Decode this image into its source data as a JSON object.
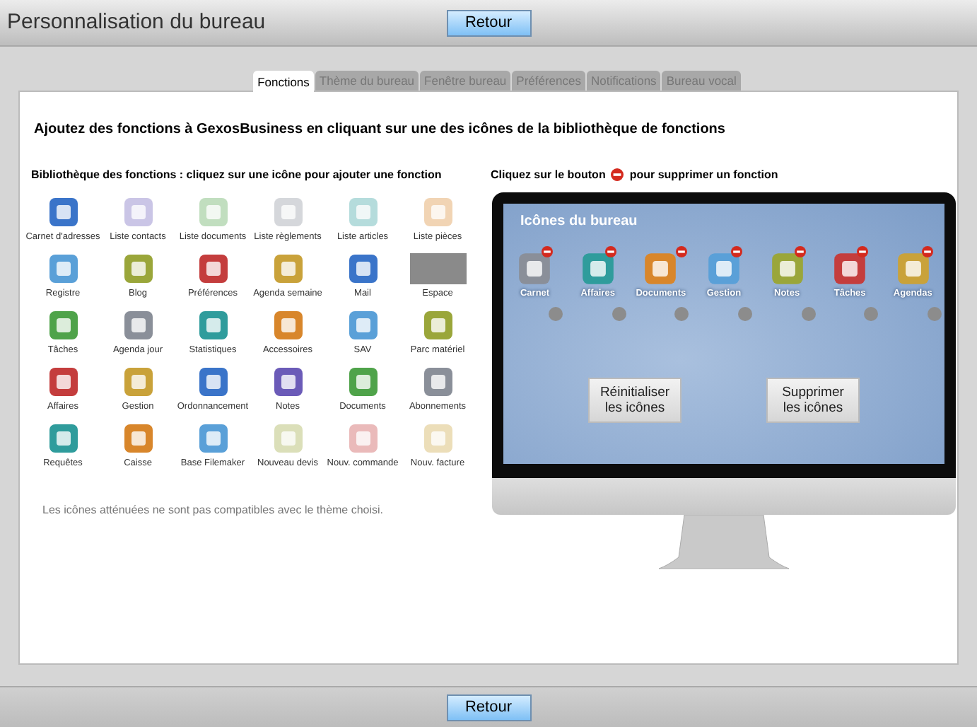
{
  "window": {
    "title": "Personnalisation du bureau"
  },
  "top_button": "Retour",
  "tabs": [
    {
      "label": "Fonctions",
      "selected": true
    },
    {
      "label": "Thème du bureau",
      "selected": false
    },
    {
      "label": "Fenêtre bureau",
      "selected": false
    },
    {
      "label": "Préférences",
      "selected": false
    },
    {
      "label": "Notifications",
      "selected": false
    },
    {
      "label": "Bureau vocal",
      "selected": false
    }
  ],
  "heading": "Ajoutez des fonctions à GexosBusiness en cliquant sur une  des icônes de la bibliothèque de fonctions",
  "library": {
    "title": "Bibliothèque des fonctions : cliquez sur une icône pour ajouter une fonction",
    "items": [
      {
        "label": "Carnet d'adresses",
        "kind": "icon",
        "dimmed": false
      },
      {
        "label": "Liste contacts",
        "kind": "icon",
        "dimmed": true
      },
      {
        "label": "Liste documents",
        "kind": "icon",
        "dimmed": true
      },
      {
        "label": "Liste règlements",
        "kind": "icon",
        "dimmed": true
      },
      {
        "label": "Liste articles",
        "kind": "icon",
        "dimmed": true
      },
      {
        "label": "Liste pièces",
        "kind": "icon",
        "dimmed": true
      },
      {
        "label": "Registre",
        "kind": "icon",
        "dimmed": false
      },
      {
        "label": "Blog",
        "kind": "icon",
        "dimmed": false
      },
      {
        "label": "Préférences",
        "kind": "icon",
        "dimmed": false
      },
      {
        "label": "Agenda semaine",
        "kind": "icon",
        "dimmed": false
      },
      {
        "label": "Mail",
        "kind": "icon",
        "dimmed": false
      },
      {
        "label": "Espace",
        "kind": "space",
        "dimmed": false
      },
      {
        "label": "Tâches",
        "kind": "icon",
        "dimmed": false
      },
      {
        "label": "Agenda jour",
        "kind": "icon",
        "dimmed": false
      },
      {
        "label": "Statistiques",
        "kind": "icon",
        "dimmed": false
      },
      {
        "label": "Accessoires",
        "kind": "icon",
        "dimmed": false
      },
      {
        "label": "SAV",
        "kind": "icon",
        "dimmed": false
      },
      {
        "label": "Parc matériel",
        "kind": "icon",
        "dimmed": false
      },
      {
        "label": "Affaires",
        "kind": "icon",
        "dimmed": false
      },
      {
        "label": "Gestion",
        "kind": "icon",
        "dimmed": false
      },
      {
        "label": "Ordonnancement",
        "kind": "icon",
        "dimmed": false
      },
      {
        "label": "Notes",
        "kind": "icon",
        "dimmed": false
      },
      {
        "label": "Documents",
        "kind": "icon",
        "dimmed": false
      },
      {
        "label": "Abonnements",
        "kind": "icon",
        "dimmed": false
      },
      {
        "label": "Requêtes",
        "kind": "icon",
        "dimmed": false
      },
      {
        "label": "Caisse",
        "kind": "icon",
        "dimmed": false
      },
      {
        "label": "Base Filemaker",
        "kind": "icon",
        "dimmed": false
      },
      {
        "label": "Nouveau devis",
        "kind": "icon",
        "dimmed": true
      },
      {
        "label": "Nouv. commande",
        "kind": "icon",
        "dimmed": true
      },
      {
        "label": "Nouv. facture",
        "kind": "icon",
        "dimmed": true
      }
    ],
    "note": "Les icônes atténuées ne sont pas compatibles avec le thème choisi."
  },
  "desktop": {
    "hint_before": "Cliquez sur le bouton",
    "hint_after": "pour supprimer un fonction",
    "screen_title": "Icônes du bureau",
    "icons": [
      "Carnet",
      "Affaires",
      "Documents",
      "Gestion",
      "Notes",
      "Tâches",
      "Agendas"
    ],
    "buttons": [
      "Réinitialiser les icônes",
      "Supprimer les icônes"
    ]
  },
  "bottom_button": "Retour"
}
